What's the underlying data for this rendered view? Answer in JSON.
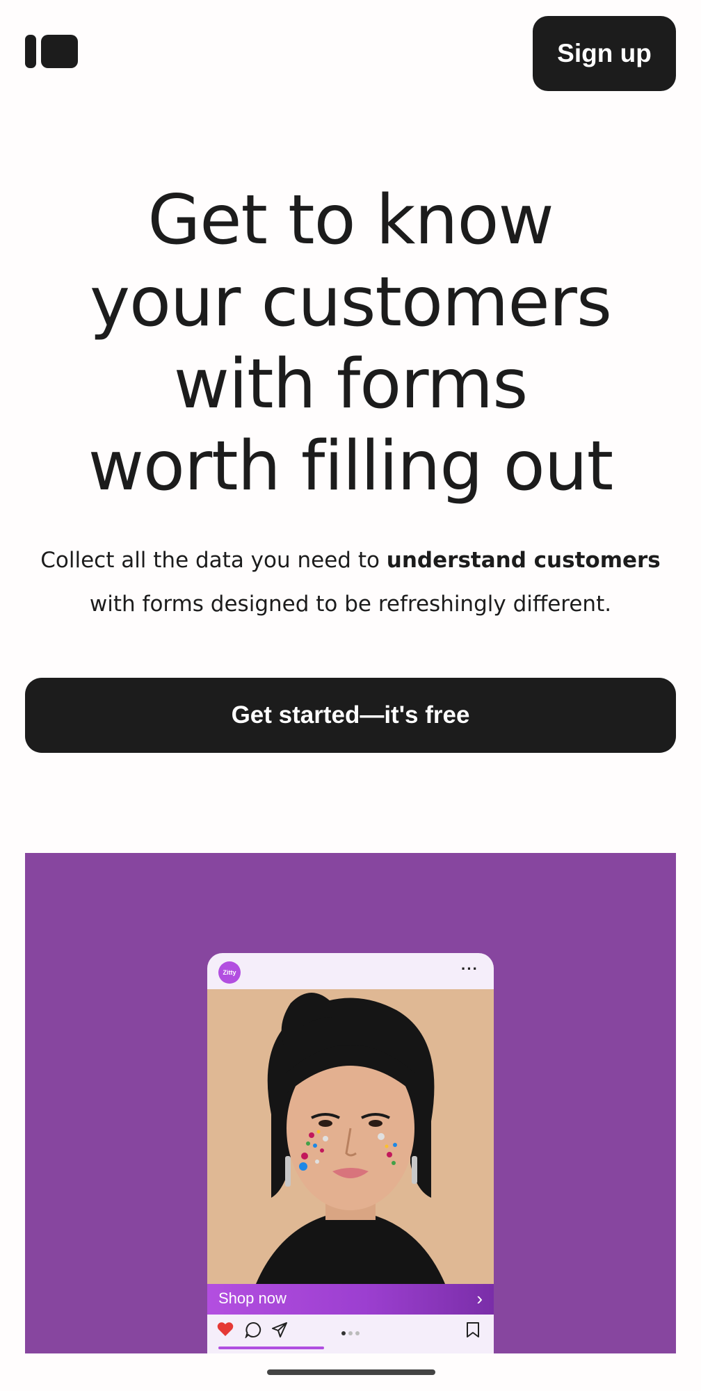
{
  "header": {
    "logo_icon": "brand-logo-icon",
    "signup_label": "Sign up"
  },
  "hero": {
    "title_lines": [
      "Get to know",
      "your customers",
      "with forms",
      "worth filling out"
    ],
    "subtitle_prefix": "Collect all the data you need to ",
    "subtitle_bold": "understand customers",
    "subtitle_suffix": " with forms designed to be refreshingly different.",
    "cta_label": "Get started—it's free"
  },
  "showcase": {
    "background": "#87469f",
    "card": {
      "brand_name": "Zitty",
      "more_icon": "more-horizontal-icon",
      "photo_icon": "portrait-photo-icon",
      "shop_label": "Shop now",
      "shop_icon": "chevron-right-icon",
      "carousel_active_index": 1,
      "carousel_count": 3,
      "progress_fraction": 0.4,
      "accent": "#b24fe0"
    }
  },
  "colors": {
    "text": "#1c1c1c",
    "button_bg": "#1c1c1c",
    "button_text": "#ffffff",
    "like": "#e53935"
  }
}
